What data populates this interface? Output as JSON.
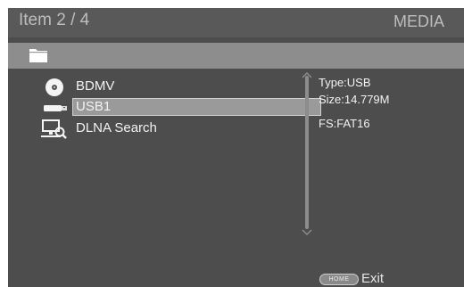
{
  "header": {
    "item_counter": "Item  2 / 4",
    "title": "MEDIA"
  },
  "pathbar": {
    "icon": "folder-icon"
  },
  "list": {
    "items": [
      {
        "label": "BDMV",
        "icon": "disc-icon"
      },
      {
        "label": "USB1",
        "icon": "usb-icon",
        "selected": true
      },
      {
        "label": "DLNA Search",
        "icon": "network-search-icon"
      }
    ]
  },
  "info": {
    "type": "Type:USB",
    "size": "Size:14.779M",
    "fs": "FS:FAT16"
  },
  "footer": {
    "home_label": "HOME",
    "exit_label": "Exit"
  },
  "colors": {
    "background": "#4d4d4d",
    "header": "#595959",
    "pathbar": "#8d8d8d",
    "highlight": "#9a9a9a",
    "text": "#f2f2f2"
  }
}
